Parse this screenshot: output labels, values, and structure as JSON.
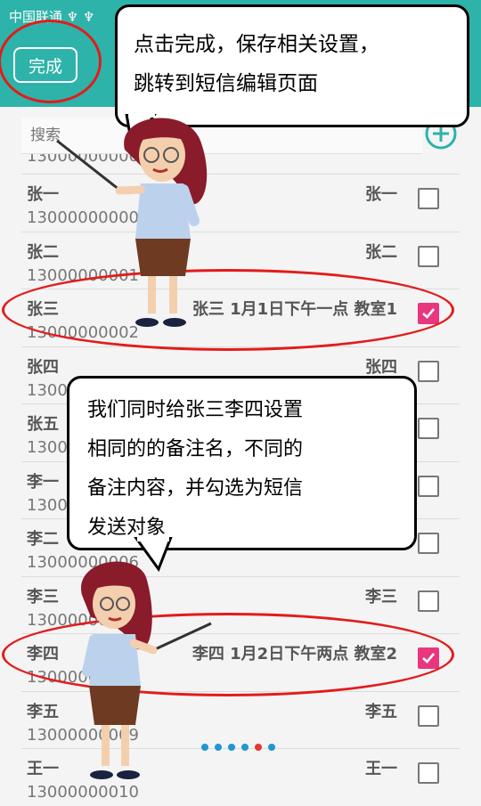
{
  "status": {
    "carrier": "中国联通 ♆ ♆"
  },
  "toolbar": {
    "done_label": "完成"
  },
  "search": {
    "placeholder": "搜索"
  },
  "list": [
    {
      "name": "张一",
      "phone": "13000000000",
      "remark": "张一",
      "checked": false
    },
    {
      "name": "张二",
      "phone": "13000000001",
      "remark": "张二",
      "checked": false
    },
    {
      "name": "张三",
      "phone": "13000000002",
      "remark": "张三 1月1日下午一点 教室1",
      "checked": true
    },
    {
      "name": "张四",
      "phone": "13000000003",
      "remark": "张四",
      "checked": false
    },
    {
      "name": "张五",
      "phone": "13000000004",
      "remark": "",
      "checked": false
    },
    {
      "name": "李一",
      "phone": "13000000005",
      "remark": "",
      "checked": false
    },
    {
      "name": "李二",
      "phone": "13000000006",
      "remark": "",
      "checked": false
    },
    {
      "name": "李三",
      "phone": "13000000007",
      "remark": "李三",
      "checked": false
    },
    {
      "name": "李四",
      "phone": "13000000008",
      "remark": "李四 1月2日下午两点 教室2",
      "checked": true
    },
    {
      "name": "李五",
      "phone": "13000000009",
      "remark": "李五",
      "checked": false
    },
    {
      "name": "王一",
      "phone": "13000000010",
      "remark": "王一",
      "checked": false
    }
  ],
  "pager": {
    "count": 6,
    "active": 4
  },
  "annotations": {
    "top": [
      "点击完成，保存相关设置，",
      "跳转到短信编辑页面"
    ],
    "middle": [
      "我们同时给张三李四设置",
      "相同的的备注名，不同的",
      "备注内容，并勾选为短信",
      "发送对象"
    ]
  },
  "colors": {
    "appbar": "#2db3a9",
    "checkbox_checked": "#e8377e",
    "highlight_oval": "#e31b1b",
    "pager_dot": "#2196d3",
    "pager_active": "#e53935"
  }
}
